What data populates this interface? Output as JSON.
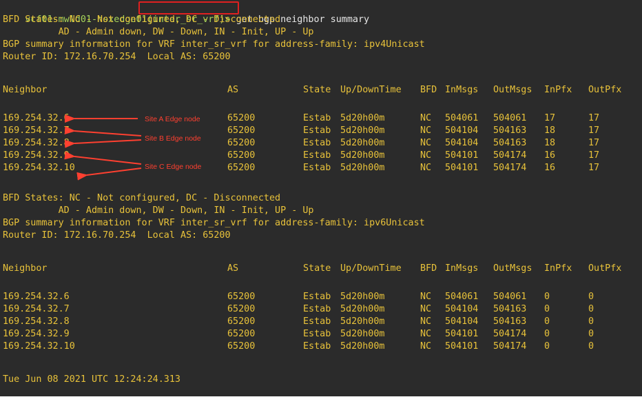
{
  "terminal": {
    "prompt_host": "vcf01-mwld01-nsxedge01",
    "prompt_vrf": "(inter_sr_vrf)",
    "prompt_suffix": ">",
    "command": " get bgp neighbor summary",
    "ipv4": {
      "bfd_legend_1": "BFD States: NC - Not configured, DC - Disconnected",
      "bfd_legend_2": "          AD - Admin down, DW - Down, IN - Init, UP - Up",
      "summary": "BGP summary information for VRF inter_sr_vrf for address-family: ipv4Unicast",
      "router": "Router ID: 172.16.70.254  Local AS: 65200"
    },
    "ipv6": {
      "bfd_legend_1": "BFD States: NC - Not configured, DC - Disconnected",
      "bfd_legend_2": "          AD - Admin down, DW - Down, IN - Init, UP - Up",
      "summary": "BGP summary information for VRF inter_sr_vrf for address-family: ipv6Unicast",
      "router": "Router ID: 172.16.70.254  Local AS: 65200"
    },
    "headers": {
      "neighbor": "Neighbor",
      "as": "AS",
      "state": "State",
      "uptime": "Up/DownTime",
      "bfd": "BFD",
      "inmsgs": "InMsgs",
      "outmsgs": "OutMsgs",
      "inpfx": "InPfx",
      "outpfx": "OutPfx"
    },
    "ipv4_rows": [
      {
        "neighbor": "169.254.32.6",
        "as": "65200",
        "state": "Estab",
        "uptime": "5d20h00m",
        "bfd": "NC",
        "inmsgs": "504061",
        "outmsgs": "504061",
        "inpfx": "17",
        "outpfx": "17"
      },
      {
        "neighbor": "169.254.32.7",
        "as": "65200",
        "state": "Estab",
        "uptime": "5d20h00m",
        "bfd": "NC",
        "inmsgs": "504104",
        "outmsgs": "504163",
        "inpfx": "18",
        "outpfx": "17"
      },
      {
        "neighbor": "169.254.32.8",
        "as": "65200",
        "state": "Estab",
        "uptime": "5d20h00m",
        "bfd": "NC",
        "inmsgs": "504104",
        "outmsgs": "504163",
        "inpfx": "18",
        "outpfx": "17"
      },
      {
        "neighbor": "169.254.32.9",
        "as": "65200",
        "state": "Estab",
        "uptime": "5d20h00m",
        "bfd": "NC",
        "inmsgs": "504101",
        "outmsgs": "504174",
        "inpfx": "16",
        "outpfx": "17"
      },
      {
        "neighbor": "169.254.32.10",
        "as": "65200",
        "state": "Estab",
        "uptime": "5d20h00m",
        "bfd": "NC",
        "inmsgs": "504101",
        "outmsgs": "504174",
        "inpfx": "16",
        "outpfx": "17"
      }
    ],
    "ipv6_rows": [
      {
        "neighbor": "169.254.32.6",
        "as": "65200",
        "state": "Estab",
        "uptime": "5d20h00m",
        "bfd": "NC",
        "inmsgs": "504061",
        "outmsgs": "504061",
        "inpfx": "0",
        "outpfx": "0"
      },
      {
        "neighbor": "169.254.32.7",
        "as": "65200",
        "state": "Estab",
        "uptime": "5d20h00m",
        "bfd": "NC",
        "inmsgs": "504104",
        "outmsgs": "504163",
        "inpfx": "0",
        "outpfx": "0"
      },
      {
        "neighbor": "169.254.32.8",
        "as": "65200",
        "state": "Estab",
        "uptime": "5d20h00m",
        "bfd": "NC",
        "inmsgs": "504104",
        "outmsgs": "504163",
        "inpfx": "0",
        "outpfx": "0"
      },
      {
        "neighbor": "169.254.32.9",
        "as": "65200",
        "state": "Estab",
        "uptime": "5d20h00m",
        "bfd": "NC",
        "inmsgs": "504101",
        "outmsgs": "504174",
        "inpfx": "0",
        "outpfx": "0"
      },
      {
        "neighbor": "169.254.32.10",
        "as": "65200",
        "state": "Estab",
        "uptime": "5d20h00m",
        "bfd": "NC",
        "inmsgs": "504101",
        "outmsgs": "504174",
        "inpfx": "0",
        "outpfx": "0"
      }
    ],
    "timestamp": "Tue Jun 08 2021 UTC 12:24:24.313"
  },
  "annotations": {
    "site_a": "Site A Edge node",
    "site_b": "Site B Edge node",
    "site_c": "Site C Edge node",
    "color": "#ff4030"
  },
  "colors": {
    "background": "#2b2b2b",
    "output_text": "#e8c23a",
    "prompt": "#a7d65a",
    "command": "#e8e8e8",
    "cursor": "#2fd12f",
    "highlight_box": "#e02020"
  }
}
